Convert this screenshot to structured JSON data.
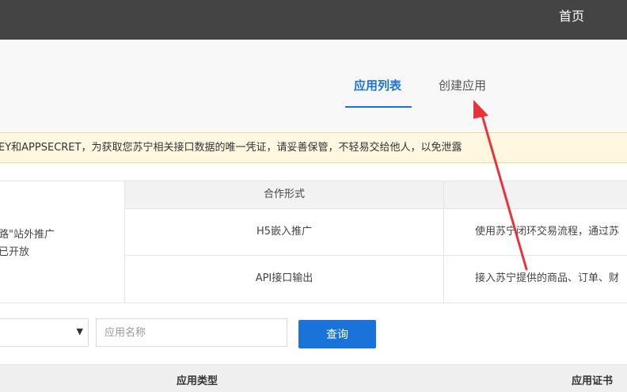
{
  "topbar": {
    "home_label": "首页"
  },
  "tabs": [
    {
      "label": "应用列表",
      "active": true
    },
    {
      "label": "创建应用",
      "active": false
    }
  ],
  "notice": {
    "text": "EY和APPSECRET，为获取您苏宁相关接口数据的唯一凭证，请妥善保管，不轻易交给他人，以免泄露"
  },
  "cooperation": {
    "left_lines": [
      "路\"站外推广",
      "已开放"
    ],
    "header": "合作形式",
    "rows": [
      {
        "form": "H5嵌入推广",
        "desc": "使用苏宁闭环交易流程，通过苏"
      },
      {
        "form": "API接口输出",
        "desc": "接入苏宁提供的商品、订单、财"
      }
    ]
  },
  "filter": {
    "select_value": "",
    "name_placeholder": "应用名称",
    "query_label": "查询"
  },
  "list_header": {
    "type_label": "应用类型",
    "cert_label": "应用证书"
  },
  "colors": {
    "accent": "#1a73d9",
    "topbar": "#444444",
    "notice_bg": "#fff8e1",
    "annotation": "#e8333b"
  }
}
